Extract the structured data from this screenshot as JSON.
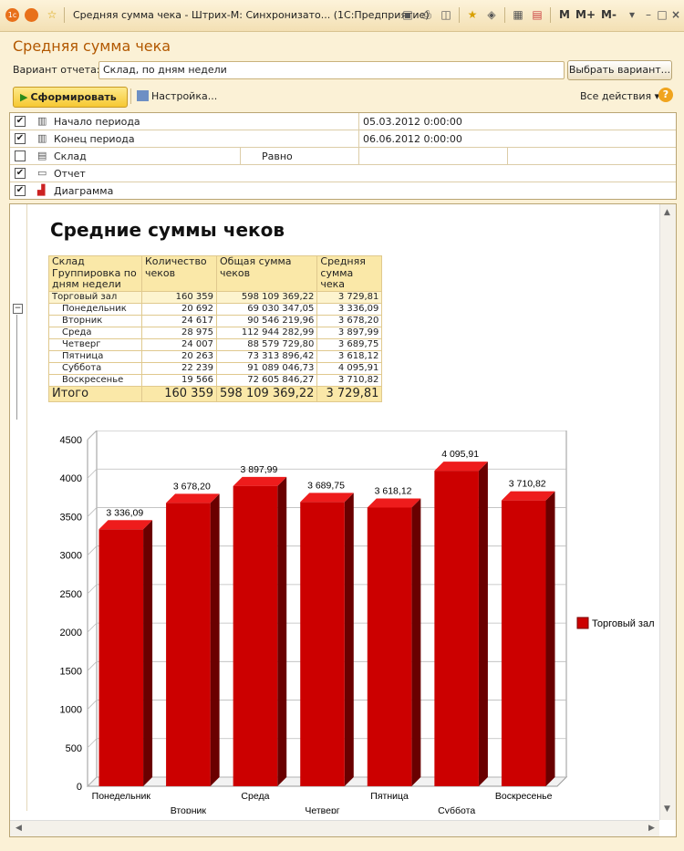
{
  "window": {
    "title": "Средняя сумма чека - Штрих-М: Синхронизато... (1С:Предприятие)",
    "m_buttons": [
      "M",
      "M+",
      "M-"
    ]
  },
  "page_title": "Средняя сумма чека",
  "variant": {
    "label": "Вариант отчета:",
    "value": "Склад, по дням недели",
    "select_button": "Выбрать вариант..."
  },
  "toolbar": {
    "generate_button": "Сформировать",
    "settings_button": "Настройка...",
    "all_actions": "Все действия",
    "help": "?"
  },
  "settings": [
    {
      "checked": true,
      "icon": "calendar-icon",
      "name": "Начало периода",
      "condition": "",
      "value": "05.03.2012 0:00:00"
    },
    {
      "checked": true,
      "icon": "calendar-icon",
      "name": "Конец периода",
      "condition": "",
      "value": "06.06.2012 0:00:00"
    },
    {
      "checked": false,
      "icon": "warehouse-icon",
      "name": "Склад",
      "condition": "Равно",
      "value": ""
    },
    {
      "checked": true,
      "icon": "table-icon",
      "name": "Отчет",
      "condition": "",
      "value": ""
    },
    {
      "checked": true,
      "icon": "chart-icon",
      "name": "Диаграмма",
      "condition": "",
      "value": ""
    }
  ],
  "report": {
    "title": "Средние суммы чеков",
    "headers": {
      "col1": [
        "Склад",
        "Группировка по",
        "дням недели"
      ],
      "col2": [
        "Количество",
        "чеков"
      ],
      "col3": [
        "Общая сумма",
        "чеков"
      ],
      "col4": [
        "Средняя",
        "сумма",
        "чека"
      ]
    },
    "group": {
      "name": "Торговый зал",
      "count": "160 359",
      "total": "598 109 369,22",
      "avg": "3 729,81"
    },
    "rows": [
      {
        "name": "Понедельник",
        "count": "20 692",
        "total": "69 030 347,05",
        "avg": "3 336,09"
      },
      {
        "name": "Вторник",
        "count": "24 617",
        "total": "90 546 219,96",
        "avg": "3 678,20"
      },
      {
        "name": "Среда",
        "count": "28 975",
        "total": "112 944 282,99",
        "avg": "3 897,99"
      },
      {
        "name": "Четверг",
        "count": "24 007",
        "total": "88 579 729,80",
        "avg": "3 689,75"
      },
      {
        "name": "Пятница",
        "count": "20 263",
        "total": "73 313 896,42",
        "avg": "3 618,12"
      },
      {
        "name": "Суббота",
        "count": "22 239",
        "total": "91 089 046,73",
        "avg": "4 095,91"
      },
      {
        "name": "Воскресенье",
        "count": "19 566",
        "total": "72 605 846,27",
        "avg": "3 710,82"
      }
    ],
    "total": {
      "name": "Итого",
      "count": "160 359",
      "total": "598 109 369,22",
      "avg": "3 729,81"
    }
  },
  "chart_data": {
    "type": "bar",
    "categories": [
      "Понедельник",
      "Вторник",
      "Среда",
      "Четверг",
      "Пятница",
      "Суббота",
      "Воскресенье"
    ],
    "series": [
      {
        "name": "Торговый зал",
        "values": [
          3336.09,
          3678.2,
          3897.99,
          3689.75,
          3618.12,
          4095.91,
          3710.82
        ],
        "labels": [
          "3 336,09",
          "3 678,20",
          "3 897,99",
          "3 689,75",
          "3 618,12",
          "4 095,91",
          "3 710,82"
        ],
        "color": "#cc0000"
      }
    ],
    "yticks": [
      "0",
      "500",
      "1000",
      "1500",
      "2000",
      "2500",
      "3000",
      "3500",
      "4000",
      "4500"
    ],
    "ylim": [
      0,
      4500
    ],
    "grid": true,
    "legend": "right",
    "style": "3d"
  },
  "colors": {
    "accent": "#b25800",
    "background": "#fbf1d6",
    "bar": "#cc0000"
  }
}
